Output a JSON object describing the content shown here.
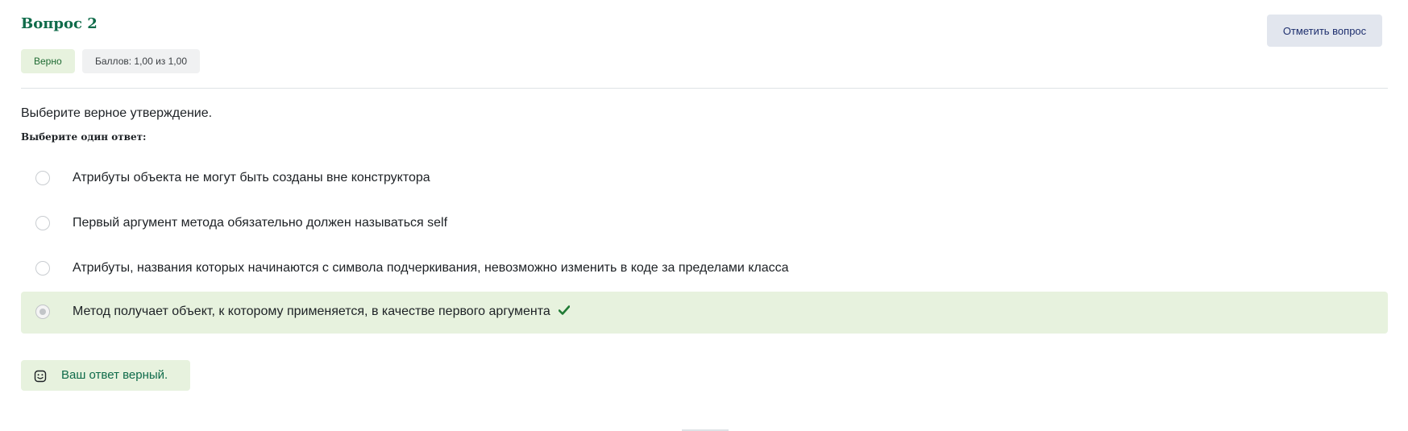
{
  "question": {
    "title": "Вопрос 2",
    "status_badge": "Верно",
    "score_badge": "Баллов: 1,00 из 1,00",
    "flag_button": "Отметить вопрос",
    "text": "Выберите верное утверждение.",
    "prompt": "Выберите один ответ:"
  },
  "answers": [
    {
      "label": "Атрибуты объекта не могут быть созданы вне конструктора",
      "selected": false,
      "correct": false
    },
    {
      "label": "Первый аргумент метода обязательно должен называться self",
      "selected": false,
      "correct": false
    },
    {
      "label": "Атрибуты, названия которых начинаются с символа подчеркивания, невозможно изменить в коде за пределами класса",
      "selected": false,
      "correct": false
    },
    {
      "label": "Метод получает объект, к которому применяется, в качестве первого аргумента",
      "selected": true,
      "correct": true
    }
  ],
  "feedback": {
    "text": "Ваш ответ верный.",
    "icon": "smile-icon"
  },
  "colors": {
    "accent_green": "#0f6b4a",
    "correct_bg": "#e7f2de",
    "flag_button_bg": "#e2e6ee",
    "check_green": "#1f7a34"
  }
}
